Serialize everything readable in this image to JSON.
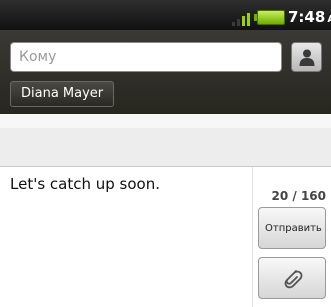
{
  "status_bar": {
    "time": "7:48",
    "ampm": "AM",
    "signal_bars": 4,
    "signal_active": 2,
    "icons": [
      "signal-icon",
      "battery-icon"
    ]
  },
  "recipients": {
    "to_placeholder": "Кому",
    "to_value": "",
    "chip_name": "Diana Mayer"
  },
  "compose": {
    "message_text": "Let's catch up soon.",
    "char_count": "20 / 160",
    "send_label": "Отправить"
  },
  "colors": {
    "header_bg": "#2c2b26",
    "battery": "#8fd400"
  }
}
